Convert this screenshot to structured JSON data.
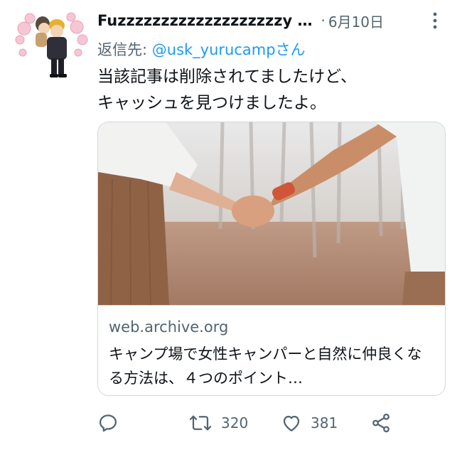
{
  "tweet": {
    "display_name": "Fuzzzzzzzzzzzzzzzzzzzy …",
    "separator": "·",
    "date": "6月10日",
    "reply_prefix": "返信先:",
    "reply_handle": "@usk_yurucampさん",
    "text": "当該記事は削除されてましたけど、\nキャッシュを見つけましたよ。"
  },
  "card": {
    "domain": "web.archive.org",
    "title": "キャンプ場で女性キャンパーと自然に仲良くなる方法は、４つのポイント…"
  },
  "actions": {
    "reply": {
      "icon": "reply-icon"
    },
    "retweet": {
      "icon": "retweet-icon",
      "count": "320"
    },
    "like": {
      "icon": "heart-icon",
      "count": "381"
    },
    "share": {
      "icon": "share-icon"
    }
  },
  "colors": {
    "text": "#0f1419",
    "secondary": "#536471",
    "link": "#1d9bf0",
    "border": "#cfd9de"
  }
}
